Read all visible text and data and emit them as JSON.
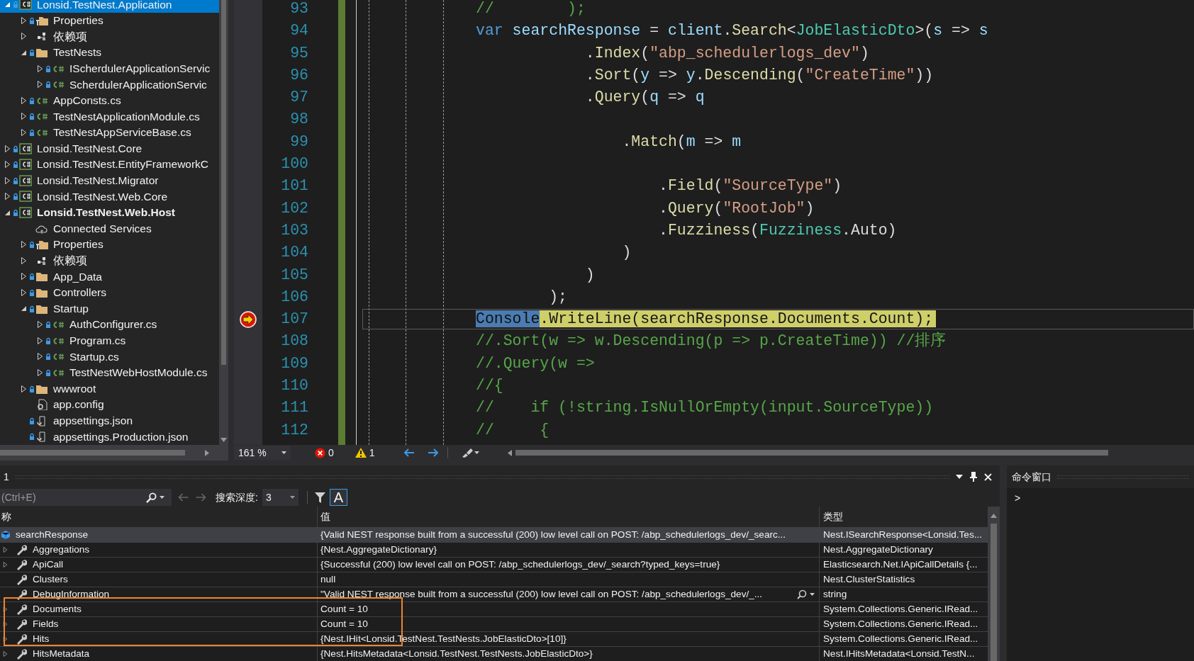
{
  "solution_explorer": {
    "items": [
      {
        "label": "Lonsid.TestNest.Application",
        "kind": "project",
        "expanded": true,
        "locked": true,
        "selected": true,
        "bold": false,
        "children": [
          {
            "label": "Properties",
            "kind": "properties",
            "expanded": false,
            "locked": true,
            "selected": false,
            "bold": false
          },
          {
            "label": "依赖项",
            "kind": "deps",
            "expanded": false,
            "locked": false,
            "selected": false,
            "bold": false
          },
          {
            "label": "TestNests",
            "kind": "folder",
            "expanded": true,
            "locked": true,
            "selected": false,
            "bold": false,
            "children": [
              {
                "label": "IScherdulerApplicationServic",
                "kind": "cs",
                "expanded": false,
                "locked": true,
                "selected": false,
                "bold": false
              },
              {
                "label": "ScherdulerApplicationServic",
                "kind": "cs",
                "expanded": false,
                "locked": true,
                "selected": false,
                "bold": false
              }
            ]
          },
          {
            "label": "AppConsts.cs",
            "kind": "cs",
            "expanded": false,
            "locked": true,
            "selected": false,
            "bold": false
          },
          {
            "label": "TestNestApplicationModule.cs",
            "kind": "cs",
            "expanded": false,
            "locked": true,
            "selected": false,
            "bold": false
          },
          {
            "label": "TestNestAppServiceBase.cs",
            "kind": "cs",
            "expanded": false,
            "locked": true,
            "selected": false,
            "bold": false
          }
        ]
      },
      {
        "label": "Lonsid.TestNest.Core",
        "kind": "project",
        "expanded": false,
        "locked": true,
        "selected": false,
        "bold": false
      },
      {
        "label": "Lonsid.TestNest.EntityFrameworkC",
        "kind": "project",
        "expanded": false,
        "locked": true,
        "selected": false,
        "bold": false
      },
      {
        "label": "Lonsid.TestNest.Migrator",
        "kind": "project",
        "expanded": false,
        "locked": true,
        "selected": false,
        "bold": false
      },
      {
        "label": "Lonsid.TestNest.Web.Core",
        "kind": "project",
        "expanded": false,
        "locked": true,
        "selected": false,
        "bold": false
      },
      {
        "label": "Lonsid.TestNest.Web.Host",
        "kind": "project",
        "expanded": true,
        "locked": true,
        "selected": false,
        "bold": true,
        "children": [
          {
            "label": "Connected Services",
            "kind": "cloud",
            "locked": false,
            "selected": false,
            "bold": false
          },
          {
            "label": "Properties",
            "kind": "properties",
            "expanded": false,
            "locked": true,
            "selected": false,
            "bold": false
          },
          {
            "label": "依赖项",
            "kind": "deps",
            "expanded": false,
            "locked": false,
            "selected": false,
            "bold": false
          },
          {
            "label": "App_Data",
            "kind": "folder",
            "expanded": false,
            "locked": true,
            "selected": false,
            "bold": false
          },
          {
            "label": "Controllers",
            "kind": "folder",
            "expanded": false,
            "locked": true,
            "selected": false,
            "bold": false
          },
          {
            "label": "Startup",
            "kind": "folder",
            "expanded": true,
            "locked": true,
            "selected": false,
            "bold": false,
            "children": [
              {
                "label": "AuthConfigurer.cs",
                "kind": "cs",
                "expanded": false,
                "locked": true,
                "selected": false,
                "bold": false
              },
              {
                "label": "Program.cs",
                "kind": "cs",
                "expanded": false,
                "locked": true,
                "selected": false,
                "bold": false
              },
              {
                "label": "Startup.cs",
                "kind": "cs",
                "expanded": false,
                "locked": true,
                "selected": false,
                "bold": false
              },
              {
                "label": "TestNestWebHostModule.cs",
                "kind": "cs",
                "expanded": false,
                "locked": true,
                "selected": false,
                "bold": false
              }
            ]
          },
          {
            "label": "wwwroot",
            "kind": "folder",
            "expanded": false,
            "locked": true,
            "selected": false,
            "bold": false
          },
          {
            "label": "app.config",
            "kind": "config",
            "locked": false,
            "selected": false,
            "bold": false
          },
          {
            "label": "appsettings.json",
            "kind": "json",
            "locked": true,
            "selected": false,
            "bold": false
          },
          {
            "label": "appsettings.Production.json",
            "kind": "json",
            "locked": true,
            "selected": false,
            "bold": false
          }
        ]
      }
    ]
  },
  "editor": {
    "lines": [
      {
        "number": "93",
        "current": false,
        "tokens": [
          {
            "text": "//        );",
            "kind": "comment"
          }
        ]
      },
      {
        "number": "94",
        "current": false,
        "tokens": [
          {
            "text": "var",
            "kind": "keyword"
          },
          {
            "text": " searchResponse",
            "kind": "local"
          },
          {
            "text": " = ",
            "kind": "plain"
          },
          {
            "text": "client",
            "kind": "local"
          },
          {
            "text": ".",
            "kind": "plain"
          },
          {
            "text": "Search",
            "kind": "method"
          },
          {
            "text": "<",
            "kind": "plain"
          },
          {
            "text": "JobElasticDto",
            "kind": "type"
          },
          {
            "text": ">(",
            "kind": "plain"
          },
          {
            "text": "s",
            "kind": "local"
          },
          {
            "text": " => ",
            "kind": "plain"
          },
          {
            "text": "s",
            "kind": "local"
          }
        ]
      },
      {
        "number": "95",
        "current": false,
        "tokens": [
          {
            "text": "            .",
            "kind": "plain"
          },
          {
            "text": "Index",
            "kind": "method"
          },
          {
            "text": "(",
            "kind": "plain"
          },
          {
            "text": "\"abp_schedulerlogs_dev\"",
            "kind": "string"
          },
          {
            "text": ")",
            "kind": "plain"
          }
        ]
      },
      {
        "number": "96",
        "current": false,
        "tokens": [
          {
            "text": "            .",
            "kind": "plain"
          },
          {
            "text": "Sort",
            "kind": "method"
          },
          {
            "text": "(",
            "kind": "plain"
          },
          {
            "text": "y",
            "kind": "local"
          },
          {
            "text": " => ",
            "kind": "plain"
          },
          {
            "text": "y",
            "kind": "local"
          },
          {
            "text": ".",
            "kind": "plain"
          },
          {
            "text": "Descending",
            "kind": "method"
          },
          {
            "text": "(",
            "kind": "plain"
          },
          {
            "text": "\"CreateTime\"",
            "kind": "string"
          },
          {
            "text": "))",
            "kind": "plain"
          }
        ]
      },
      {
        "number": "97",
        "current": false,
        "tokens": [
          {
            "text": "            .",
            "kind": "plain"
          },
          {
            "text": "Query",
            "kind": "method"
          },
          {
            "text": "(",
            "kind": "plain"
          },
          {
            "text": "q",
            "kind": "local"
          },
          {
            "text": " => ",
            "kind": "plain"
          },
          {
            "text": "q",
            "kind": "local"
          }
        ]
      },
      {
        "number": "98",
        "current": false
      },
      {
        "number": "99",
        "current": false,
        "tokens": [
          {
            "text": "                .",
            "kind": "plain"
          },
          {
            "text": "Match",
            "kind": "method"
          },
          {
            "text": "(",
            "kind": "plain"
          },
          {
            "text": "m",
            "kind": "local"
          },
          {
            "text": " => ",
            "kind": "plain"
          },
          {
            "text": "m",
            "kind": "local"
          }
        ]
      },
      {
        "number": "100",
        "current": false
      },
      {
        "number": "101",
        "current": false,
        "tokens": [
          {
            "text": "                    .",
            "kind": "plain"
          },
          {
            "text": "Field",
            "kind": "method"
          },
          {
            "text": "(",
            "kind": "plain"
          },
          {
            "text": "\"SourceType\"",
            "kind": "string"
          },
          {
            "text": ")",
            "kind": "plain"
          }
        ]
      },
      {
        "number": "102",
        "current": false,
        "tokens": [
          {
            "text": "                    .",
            "kind": "plain"
          },
          {
            "text": "Query",
            "kind": "method"
          },
          {
            "text": "(",
            "kind": "plain"
          },
          {
            "text": "\"RootJob\"",
            "kind": "string"
          },
          {
            "text": ")",
            "kind": "plain"
          }
        ]
      },
      {
        "number": "103",
        "current": false,
        "tokens": [
          {
            "text": "                    .",
            "kind": "plain"
          },
          {
            "text": "Fuzziness",
            "kind": "method"
          },
          {
            "text": "(",
            "kind": "plain"
          },
          {
            "text": "Fuzziness",
            "kind": "type"
          },
          {
            "text": ".Auto)",
            "kind": "plain"
          }
        ]
      },
      {
        "number": "104",
        "current": false,
        "tokens": [
          {
            "text": "                )",
            "kind": "plain"
          }
        ]
      },
      {
        "number": "105",
        "current": false,
        "tokens": [
          {
            "text": "            )",
            "kind": "plain"
          }
        ]
      },
      {
        "number": "106",
        "current": false,
        "tokens": [
          {
            "text": "        );",
            "kind": "plain"
          }
        ]
      },
      {
        "number": "107",
        "current": true,
        "tokens": [
          {
            "text": "Console",
            "kind": "selection"
          },
          {
            "text": ".WriteLine(searchResponse.Documents.Count);",
            "kind": "plain"
          }
        ]
      },
      {
        "number": "108",
        "current": false,
        "tokens": [
          {
            "text": "//.Sort(w => w.Descending(p => p.CreateTime)) //排序",
            "kind": "comment"
          }
        ]
      },
      {
        "number": "109",
        "current": false,
        "tokens": [
          {
            "text": "//.Query(w =>",
            "kind": "comment"
          }
        ]
      },
      {
        "number": "110",
        "current": false,
        "tokens": [
          {
            "text": "//{",
            "kind": "comment"
          }
        ]
      },
      {
        "number": "111",
        "current": false,
        "tokens": [
          {
            "text": "//    if (!string.IsNullOrEmpty(input.SourceType))",
            "kind": "comment"
          }
        ]
      },
      {
        "number": "112",
        "current": false,
        "tokens": [
          {
            "text": "//     {",
            "kind": "comment"
          }
        ]
      }
    ],
    "status": {
      "zoom": "161 %",
      "errors": "0",
      "warnings": "1"
    }
  },
  "locals": {
    "title": "1",
    "search": {
      "placeholder": "(Ctrl+E)"
    },
    "depth_label": "搜索深度:",
    "depth_value": "3",
    "match_case": {
      "label": "A",
      "on": true
    },
    "columns": [
      "称",
      "值",
      "类型"
    ],
    "rows": [
      {
        "name": "searchResponse",
        "value": "{Valid NEST response built from a successful (200) low level call on POST: /abp_schedulerlogs_dev/_searc...",
        "type": "Nest.ISearchResponse<Lonsid.Tes...",
        "kind": "object",
        "selected": true,
        "visualizer": false,
        "children": [
          {
            "name": "Aggregations",
            "value": "{Nest.AggregateDictionary}",
            "type": "Nest.AggregateDictionary",
            "kind": "property",
            "expanded": false,
            "selected": false,
            "visualizer": false
          },
          {
            "name": "ApiCall",
            "value": "{Successful (200) low level call on POST: /abp_schedulerlogs_dev/_search?typed_keys=true}",
            "type": "Elasticsearch.Net.IApiCallDetails {...",
            "kind": "property",
            "expanded": false,
            "selected": false,
            "visualizer": false
          },
          {
            "name": "Clusters",
            "value": "null",
            "type": "Nest.ClusterStatistics",
            "kind": "property",
            "selected": false,
            "visualizer": false
          },
          {
            "name": "DebugInformation",
            "value": "\"Valid NEST response built from a successful (200) low level call on POST: /abp_schedulerlogs_dev/_...",
            "type": "string",
            "kind": "property",
            "selected": false,
            "visualizer": true
          },
          {
            "name": "Documents",
            "value": "Count = 10",
            "type": "System.Collections.Generic.IRead...",
            "kind": "property",
            "expanded": false,
            "selected": false,
            "visualizer": false
          },
          {
            "name": "Fields",
            "value": "Count = 10",
            "type": "System.Collections.Generic.IRead...",
            "kind": "property",
            "expanded": false,
            "selected": false,
            "visualizer": false
          },
          {
            "name": "Hits",
            "value": "{Nest.IHit<Lonsid.TestNest.TestNests.JobElasticDto>[10]}",
            "type": "System.Collections.Generic.IRead...",
            "kind": "property",
            "expanded": false,
            "selected": false,
            "visualizer": false
          },
          {
            "name": "HitsMetadata",
            "value": "{Nest.HitsMetadata<Lonsid.TestNest.TestNests.JobElasticDto>}",
            "type": "Nest.IHitsMetadata<Lonsid.TestN...",
            "kind": "property",
            "expanded": false,
            "selected": false,
            "visualizer": false
          }
        ]
      }
    ]
  },
  "command_window": {
    "title": "命令窗口",
    "prompt": ">"
  }
}
